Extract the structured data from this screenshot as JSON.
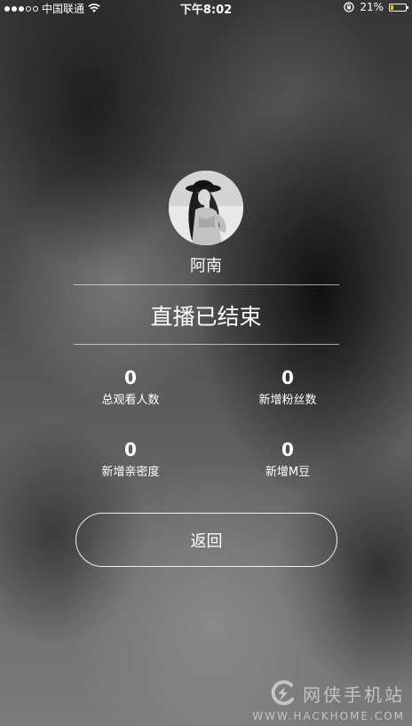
{
  "status_bar": {
    "carrier": "中国联通",
    "time": "下午8:02",
    "battery_percent": "21%",
    "battery_level": 0.21,
    "icons": [
      "signal-dots",
      "wifi-icon",
      "rotation-lock-icon",
      "battery-icon"
    ]
  },
  "host": {
    "name": "阿南"
  },
  "title": "直播已结束",
  "stats": [
    {
      "value": "0",
      "label": "总观看人数"
    },
    {
      "value": "0",
      "label": "新增粉丝数"
    },
    {
      "value": "0",
      "label": "新增亲密度"
    },
    {
      "value": "0",
      "label": "新增M豆"
    }
  ],
  "back_button": {
    "label": "返回"
  },
  "watermark": {
    "name": "网侠手机站",
    "url": "WWW.HACKHOME.COM"
  },
  "colors": {
    "text": "#ffffff",
    "battery_fill": "#f5c400"
  }
}
